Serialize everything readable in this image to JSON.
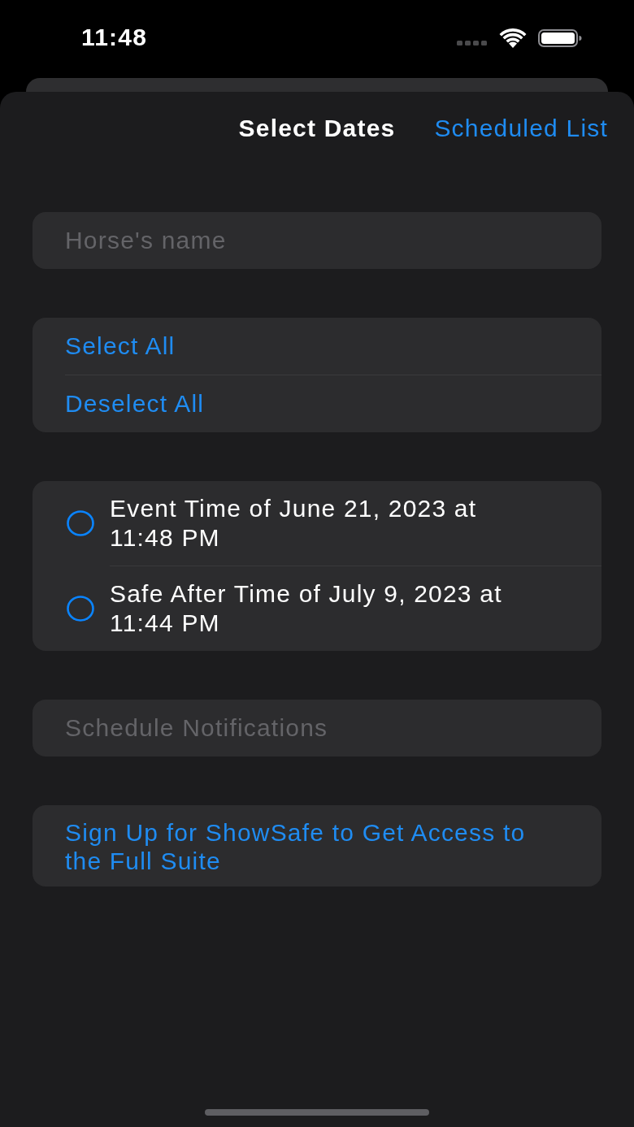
{
  "status_bar": {
    "time": "11:48"
  },
  "nav": {
    "title": "Select Dates",
    "action": "Scheduled List"
  },
  "name_field": {
    "placeholder": "Horse's name"
  },
  "selection_actions": [
    "Select All",
    "Deselect All"
  ],
  "dates": [
    {
      "label": "Event Time of June 21, 2023 at 11:48 PM",
      "selected": false
    },
    {
      "label": "Safe After Time of July 9, 2023 at 11:44 PM",
      "selected": false
    }
  ],
  "schedule_button": {
    "label": "Schedule Notifications",
    "disabled": true
  },
  "signup_link": {
    "label": "Sign Up for ShowSafe to Get Access to the Full Suite"
  }
}
